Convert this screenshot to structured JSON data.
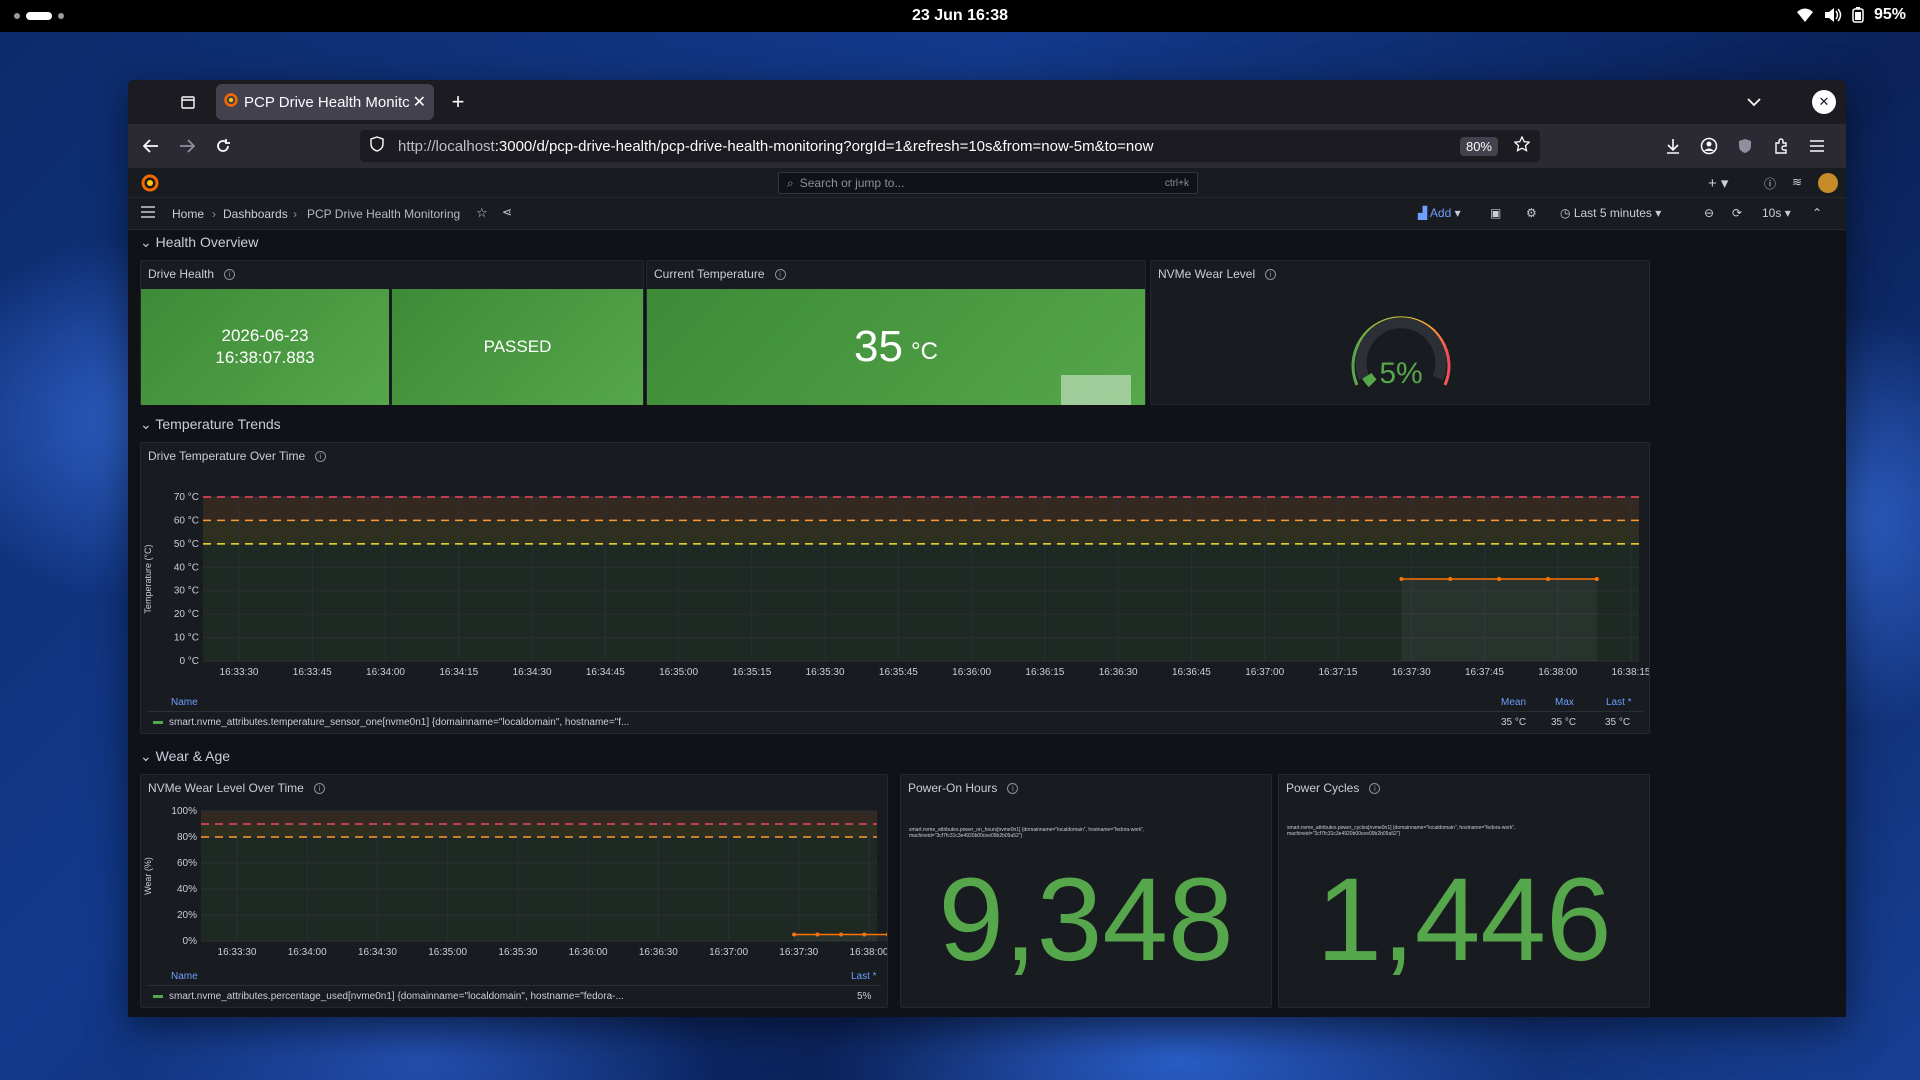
{
  "system": {
    "clock": "23 Jun  16:38",
    "battery": "95%"
  },
  "browser": {
    "tab_title": "PCP Drive Health Monitc",
    "url_host": "http://localhost",
    "url_rest": ":3000/d/pcp-drive-health/pcp-drive-health-monitoring?orgId=1&refresh=10s&from=now-5m&to=now",
    "zoom": "80%"
  },
  "grafana": {
    "search_placeholder": "Search or jump to...",
    "search_shortcut": "ctrl+k",
    "breadcrumb": [
      "Home",
      "Dashboards",
      "PCP Drive Health Monitoring"
    ],
    "add_label": "Add",
    "time_range": "Last 5 minutes",
    "refresh_interval": "10s"
  },
  "rows": {
    "health": "Health Overview",
    "temp": "Temperature Trends",
    "wear": "Wear & Age"
  },
  "panels": {
    "drive_health": {
      "title": "Drive Health",
      "timestamp_line1": "2026-06-23",
      "timestamp_line2": "16:38:07.883",
      "status": "PASSED"
    },
    "current_temp": {
      "title": "Current Temperature",
      "value": "35",
      "unit": "°C"
    },
    "nvme_wear": {
      "title": "NVMe Wear Level",
      "value": "5%",
      "gauge_percent": 5
    },
    "temp_over_time": {
      "title": "Drive Temperature Over Time",
      "legend_name_header": "Name",
      "legend_mean_header": "Mean",
      "legend_max_header": "Max",
      "legend_last_header": "Last *",
      "series_label": "smart.nvme_attributes.temperature_sensor_one[nvme0n1] {domainname=\"localdomain\", hostname=\"f...",
      "mean": "35 °C",
      "max": "35 °C",
      "last": "35 °C"
    },
    "wear_over_time": {
      "title": "NVMe Wear Level Over Time",
      "legend_name_header": "Name",
      "legend_last_header": "Last *",
      "series_label": "smart.nvme_attributes.percentage_used[nvme0n1] {domainname=\"localdomain\", hostname=\"fedora-...",
      "last": "5%"
    },
    "power_on_hours": {
      "title": "Power-On Hours",
      "caption_line1": "smart.nvme_attributes.power_on_hours[nvme0n1] {domainname=\"localdomain\", hostname=\"fedora-work\",",
      "caption_line2": "machineid=\"3cf7fc31c3e4920b00cee09b2b09a52\"}",
      "value": "9,348"
    },
    "power_cycles": {
      "title": "Power Cycles",
      "caption_line1": "smart.nvme_attributes.power_cycles[nvme0n1] {domainname=\"localdomain\", hostname=\"fedora-work\",",
      "caption_line2": "machineid=\"3cf7fc31c3e4920b00cee09b2b09a52\"}",
      "value": "1,446"
    }
  },
  "chart_data": [
    {
      "type": "line",
      "title": "Drive Temperature Over Time",
      "ylabel": "Temperature (°C)",
      "ylim": [
        0,
        70
      ],
      "yticks": [
        "70 °C",
        "60 °C",
        "50 °C",
        "40 °C",
        "30 °C",
        "20 °C",
        "10 °C",
        "0 °C"
      ],
      "xticks": [
        "16:33:30",
        "16:33:45",
        "16:34:00",
        "16:34:15",
        "16:34:30",
        "16:34:45",
        "16:35:00",
        "16:35:15",
        "16:35:30",
        "16:35:45",
        "16:36:00",
        "16:36:15",
        "16:36:30",
        "16:36:45",
        "16:37:00",
        "16:37:15",
        "16:37:30",
        "16:37:45",
        "16:38:00",
        "16:38:15"
      ],
      "thresholds": [
        {
          "value": 50,
          "color": "#fade2a"
        },
        {
          "value": 60,
          "color": "#ff9830"
        },
        {
          "value": 70,
          "color": "#f2495c"
        }
      ],
      "series": [
        {
          "color": "#ff7300",
          "x": [
            "16:37:28",
            "16:37:38",
            "16:37:48",
            "16:37:58",
            "16:38:08"
          ],
          "y": [
            35,
            35,
            35,
            35,
            35
          ]
        }
      ]
    },
    {
      "type": "line",
      "title": "NVMe Wear Level Over Time",
      "ylabel": "Wear (%)",
      "ylim": [
        0,
        100
      ],
      "yticks": [
        "100%",
        "80%",
        "60%",
        "40%",
        "20%",
        "0%"
      ],
      "xticks": [
        "16:33:30",
        "16:34:00",
        "16:34:30",
        "16:35:00",
        "16:35:30",
        "16:36:00",
        "16:36:30",
        "16:37:00",
        "16:37:30",
        "16:38:00"
      ],
      "thresholds": [
        {
          "value": 80,
          "color": "#ff9830"
        },
        {
          "value": 90,
          "color": "#f2495c"
        }
      ],
      "series": [
        {
          "color": "#ff7300",
          "x": [
            "16:37:28",
            "16:37:38",
            "16:37:48",
            "16:37:58",
            "16:38:08"
          ],
          "y": [
            5,
            5,
            5,
            5,
            5
          ]
        }
      ]
    }
  ],
  "colors": {
    "green": "#56a64b",
    "text": "#ccccdc",
    "panel": "#181b1f",
    "orange": "#ff7300"
  }
}
